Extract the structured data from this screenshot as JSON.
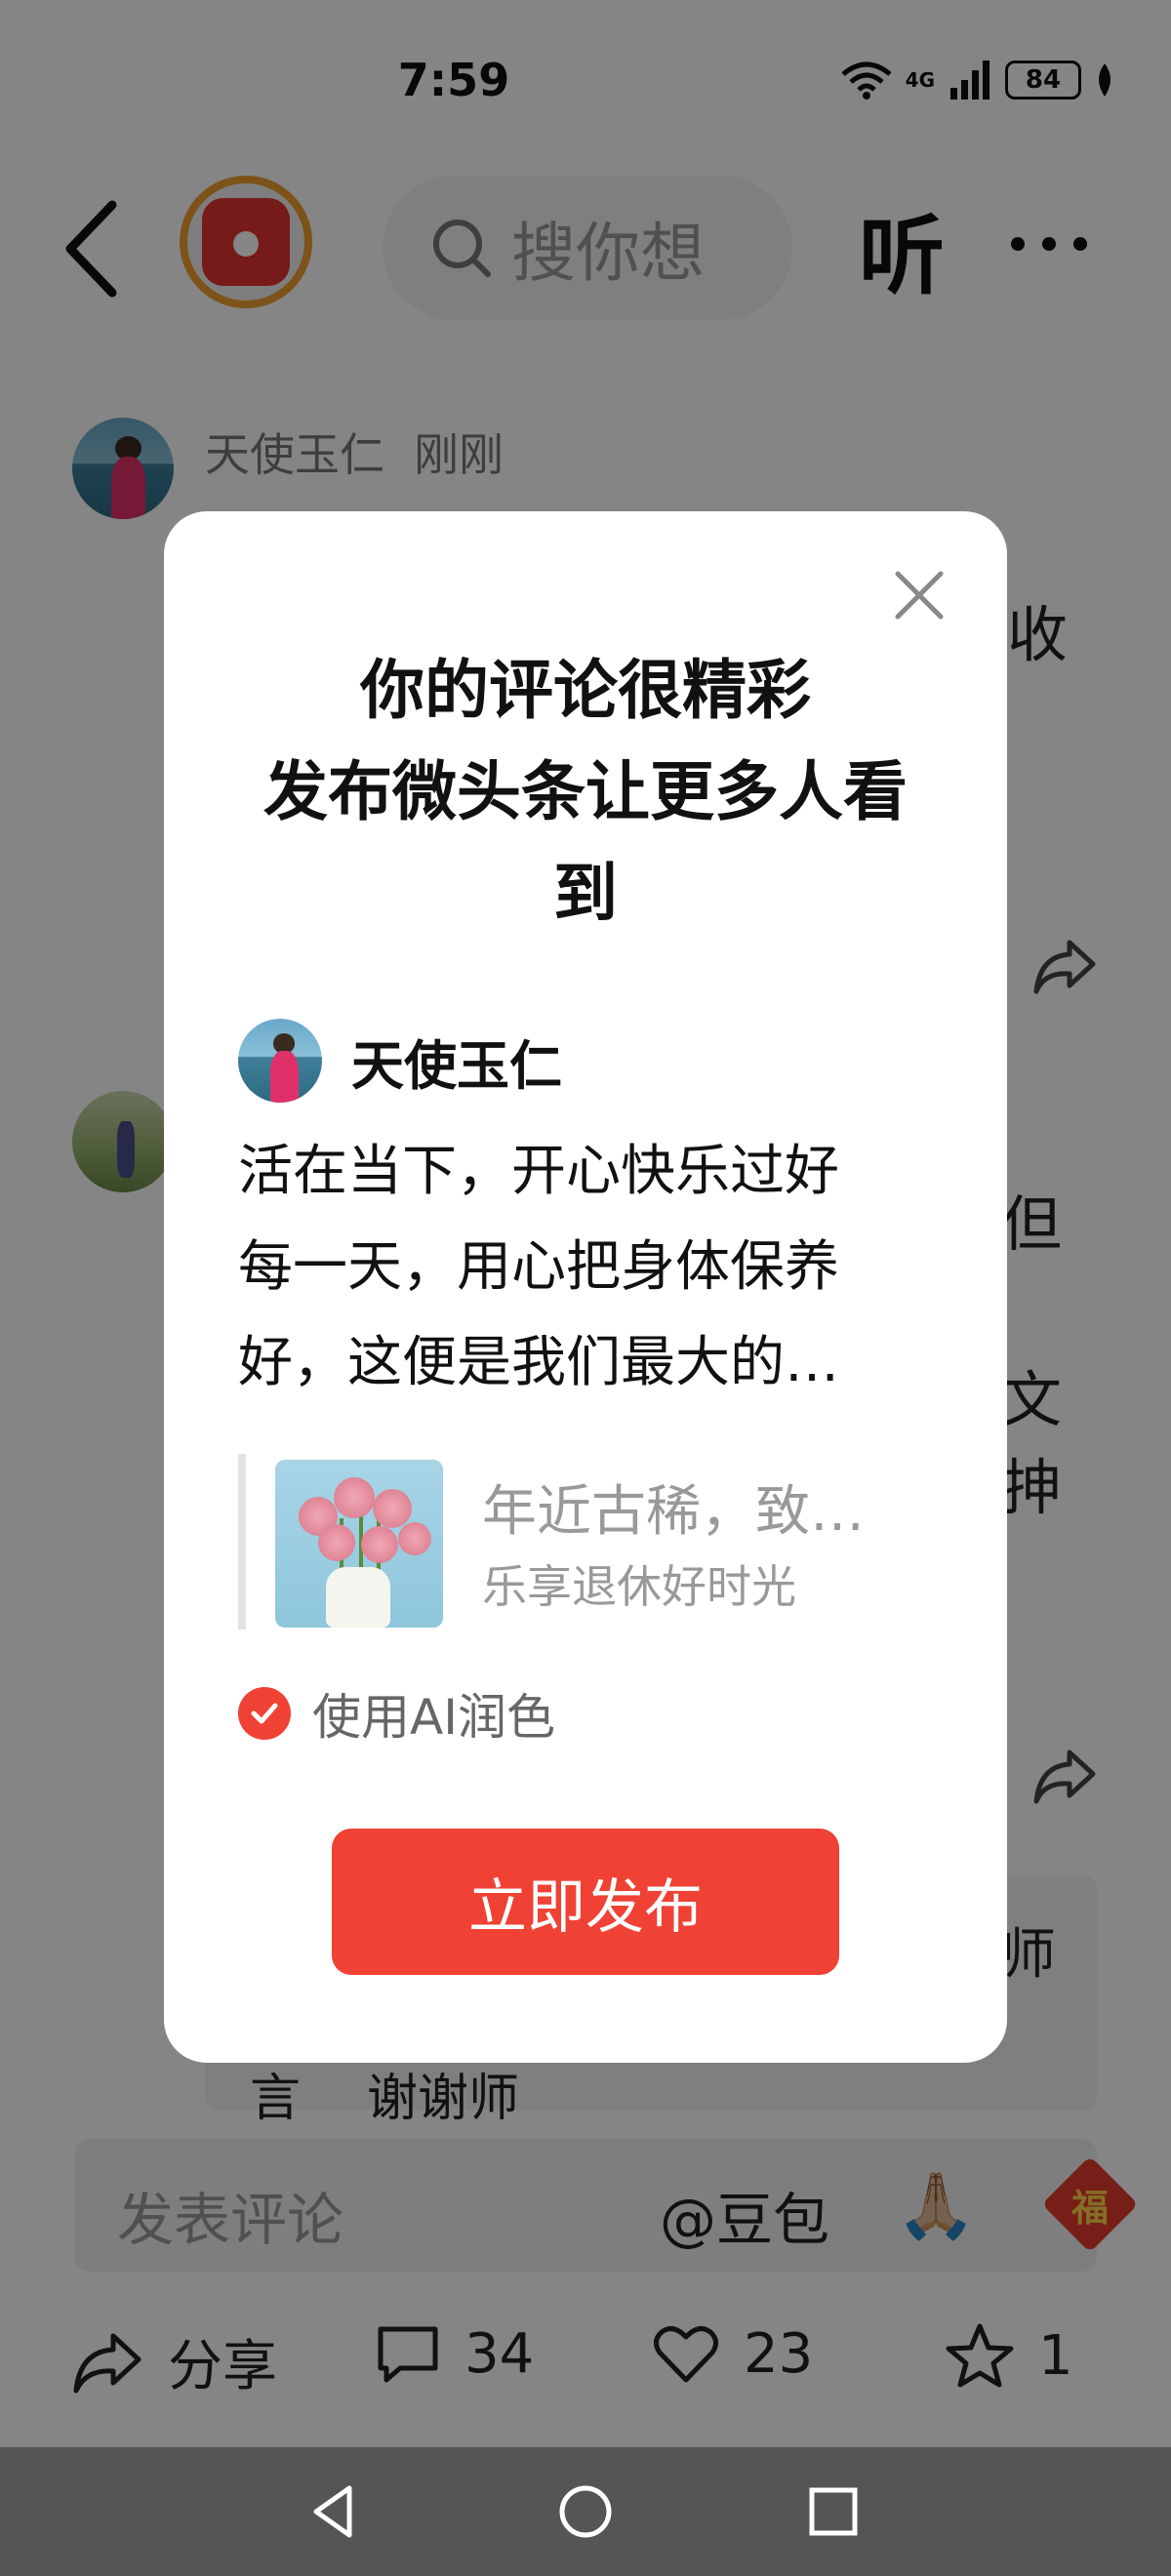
{
  "status_bar": {
    "time": "7:59",
    "network": "4G",
    "battery": "84"
  },
  "header": {
    "search_placeholder": "搜你想",
    "listen_label": "听"
  },
  "comments": [
    {
      "name": "天使玉仁",
      "time": "刚刚"
    }
  ],
  "background_fragments": [
    "收",
    "但",
    "文",
    "抻",
    "师",
    "言",
    "谢谢师"
  ],
  "dialog": {
    "title": "你的评论很精彩\n发布微头条让更多人看到",
    "title_lines": [
      "你的评论很精彩",
      "发布微头条让更多人看",
      "到"
    ],
    "user_name": "天使玉仁",
    "text_lines": [
      "活在当下，开心快乐过好",
      "每一天，用心把身体保养",
      "好，这便是我们最大的…"
    ],
    "quote_title": "年近古稀，致…",
    "quote_subtitle": "乐享退休好时光",
    "ai_polish_label": "使用AI润色",
    "ai_polish_checked": true,
    "publish_label": "立即发布"
  },
  "comment_bar": {
    "placeholder": "发表评论",
    "at_label": "@豆包",
    "emoji": "🙏🏼",
    "fu": "福"
  },
  "actions": {
    "share_label": "分享",
    "comments_count": "34",
    "likes_count": "23",
    "favorites_count": "1"
  },
  "colors": {
    "accent": "#f04135",
    "overlay": "rgba(0,0,0,0.48)"
  }
}
